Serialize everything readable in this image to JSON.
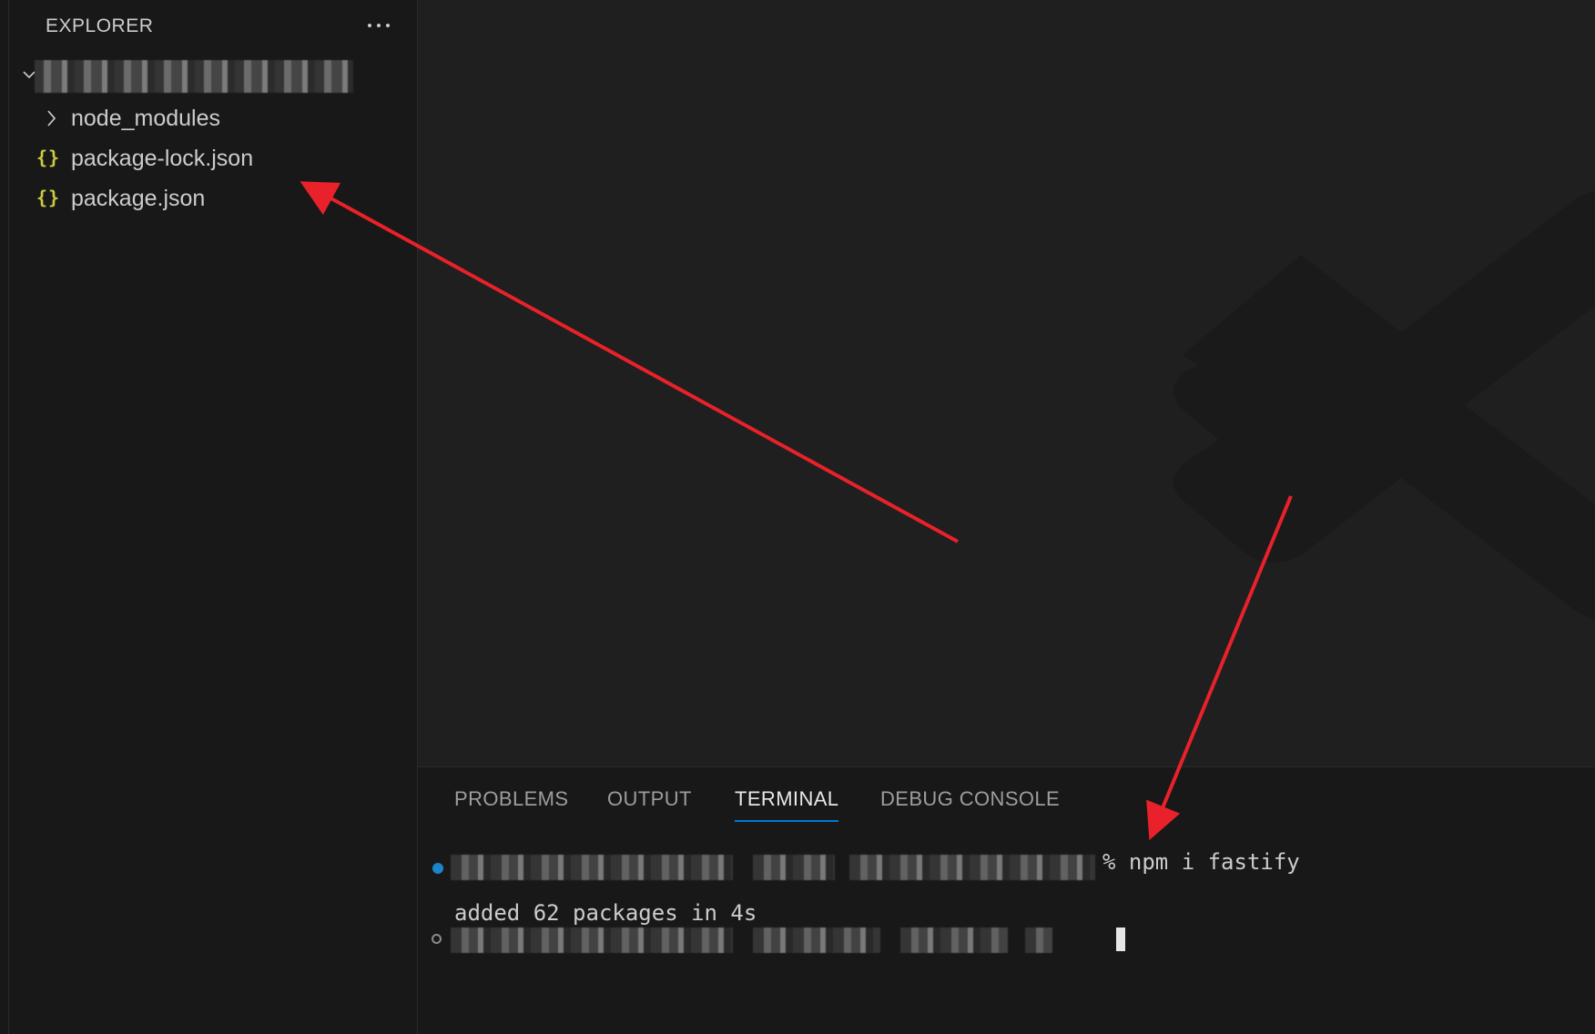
{
  "sidebar": {
    "title": "EXPLORER",
    "more_actions_icon": "ellipsis-icon",
    "items": [
      {
        "label": "node_modules",
        "icon": "chevron-right-icon"
      },
      {
        "label": "package-lock.json",
        "icon": "json-icon"
      },
      {
        "label": "package.json",
        "icon": "json-icon"
      }
    ],
    "json_icon_glyph": "{}"
  },
  "panel": {
    "tabs": [
      {
        "label": "PROBLEMS"
      },
      {
        "label": "OUTPUT"
      },
      {
        "label": "TERMINAL",
        "active": true
      },
      {
        "label": "DEBUG CONSOLE"
      }
    ],
    "terminal": {
      "command": "% npm i fastify",
      "output": "added 62 packages in 4s"
    }
  },
  "colors": {
    "accent": "#0078d4",
    "json_icon": "#cbcb41",
    "annotation_arrow": "#e8212a",
    "status_dot": "#1a85c8"
  }
}
